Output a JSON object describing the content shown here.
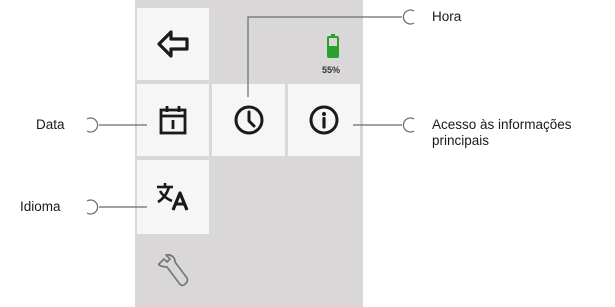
{
  "labels": {
    "hora": "Hora",
    "data": "Data",
    "acesso_line1": "Acesso às informações",
    "acesso_line2": "principais",
    "idioma": "Idioma"
  },
  "battery": {
    "level_text": "55%",
    "level": 0.55,
    "color": "#2ca02c"
  },
  "icons": {
    "back": "back-arrow-icon",
    "calendar": "calendar-icon",
    "clock": "clock-icon",
    "info": "info-icon",
    "language": "language-icon",
    "settings": "wrench-icon",
    "battery": "battery-icon"
  },
  "colors": {
    "panel": "#d9d7d8",
    "tile": "#f6f6f6",
    "icon": "#1a1a1a",
    "leader": "#6b6b6b"
  }
}
